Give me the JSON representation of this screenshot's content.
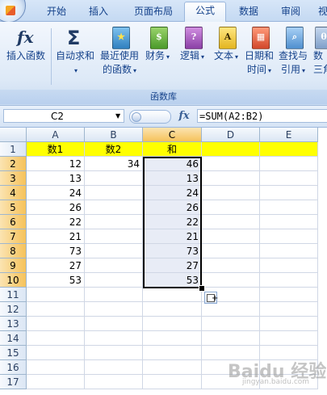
{
  "ribbon_tabs": [
    "开始",
    "插入",
    "页面布局",
    "公式",
    "数据",
    "审阅",
    "视"
  ],
  "active_tab": "公式",
  "ribbon_buttons": {
    "insert_function": {
      "label": "插入函数",
      "icon": "fx-icon"
    },
    "autosum": {
      "label": "自动求和",
      "icon": "sigma-icon"
    },
    "recent": {
      "label1": "最近使用",
      "label2": "的函数"
    },
    "financial": {
      "label": "财务"
    },
    "logical": {
      "label": "逻辑"
    },
    "text": {
      "label": "文本"
    },
    "datetime": {
      "label1": "日期和",
      "label2": "时间"
    },
    "lookup": {
      "label1": "查找与",
      "label2": "引用"
    },
    "math": {
      "label1": "数",
      "label2": "三角"
    }
  },
  "group_label": "函数库",
  "name_box": "C2",
  "fx_label": "fx",
  "formula": "=SUM(A2:B2)",
  "columns": [
    "A",
    "B",
    "C",
    "D",
    "E"
  ],
  "selected_column": "C",
  "rows": [
    "1",
    "2",
    "3",
    "4",
    "5",
    "6",
    "7",
    "8",
    "9",
    "10",
    "11",
    "12",
    "13",
    "14",
    "15",
    "16",
    "17"
  ],
  "header_row": {
    "A": "数1",
    "B": "数2",
    "C": "和"
  },
  "data_rows": [
    {
      "A": "12",
      "B": "34",
      "C": "46"
    },
    {
      "A": "13",
      "B": "",
      "C": "13"
    },
    {
      "A": "24",
      "B": "",
      "C": "24"
    },
    {
      "A": "26",
      "B": "",
      "C": "26"
    },
    {
      "A": "22",
      "B": "",
      "C": "22"
    },
    {
      "A": "21",
      "B": "",
      "C": "21"
    },
    {
      "A": "73",
      "B": "",
      "C": "73"
    },
    {
      "A": "27",
      "B": "",
      "C": "27"
    },
    {
      "A": "53",
      "B": "",
      "C": "53"
    }
  ],
  "colors": {
    "header_fill": "#ffff00",
    "selection_fill": "#e8ecf6",
    "accent": "#15428b"
  },
  "watermark": "Baidu 经验",
  "watermark_sub": "jingyan.baidu.com"
}
